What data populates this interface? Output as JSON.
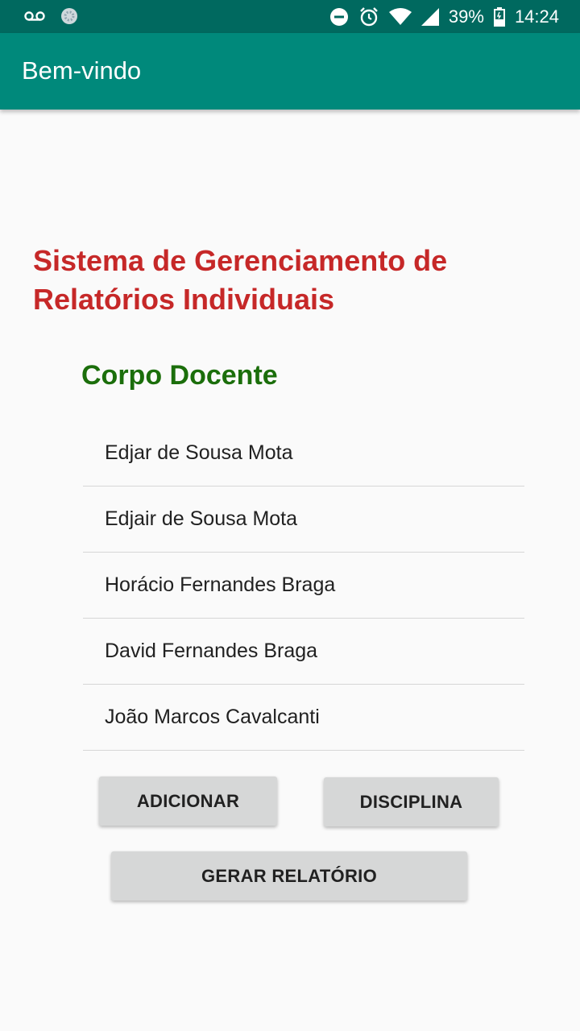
{
  "status_bar": {
    "battery": "39%",
    "time": "14:24",
    "icons": [
      "voicemail-icon",
      "app-notification-icon",
      "do-not-disturb-icon",
      "alarm-icon",
      "wifi-icon",
      "signal-icon",
      "battery-icon"
    ]
  },
  "app_bar": {
    "title": "Bem-vindo"
  },
  "main": {
    "headline": "Sistema de Gerenciamento de Relatórios Individuais",
    "section_title": "Corpo Docente",
    "teachers": [
      "Edjar de Sousa Mota",
      "Edjair de Sousa Mota",
      "Horácio Fernandes Braga",
      "David Fernandes Braga",
      "João Marcos Cavalcanti"
    ]
  },
  "buttons": {
    "add": "ADICIONAR",
    "discipline": "DISCIPLINA",
    "report": "GERAR RELATÓRIO"
  },
  "colors": {
    "status_bar": "#00695f",
    "app_bar": "#00897b",
    "headline": "#c62828",
    "section_title": "#1b6e0b",
    "button": "#d6d7d7"
  }
}
